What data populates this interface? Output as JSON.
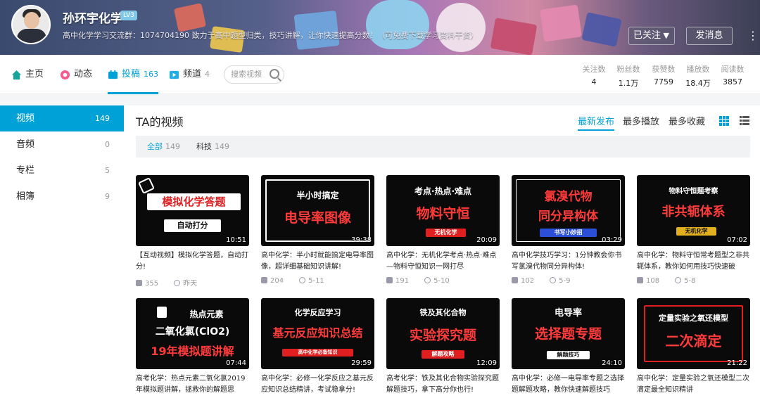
{
  "profile": {
    "username": "孙环宇化学",
    "level": "LV3",
    "sign": "高中化学学习交流群：1074704190 致力于高中题型归类，技巧讲解，让你快速提高分数！（可免费下载学习资料干货）",
    "follow_label": "已关注",
    "message_label": "发消息",
    "more_label": "⋮"
  },
  "nav": {
    "tabs": [
      {
        "label": "主页",
        "count": ""
      },
      {
        "label": "动态",
        "count": ""
      },
      {
        "label": "投稿",
        "count": "163"
      },
      {
        "label": "频道",
        "count": "4"
      }
    ],
    "search_placeholder": "搜索视频",
    "stats": [
      {
        "label": "关注数",
        "value": "4"
      },
      {
        "label": "粉丝数",
        "value": "1.1万"
      },
      {
        "label": "获赞数",
        "value": "7759"
      },
      {
        "label": "播放数",
        "value": "18.4万"
      },
      {
        "label": "阅读数",
        "value": "3857"
      }
    ]
  },
  "sidebar": {
    "items": [
      {
        "label": "视频",
        "count": "149"
      },
      {
        "label": "音频",
        "count": "0"
      },
      {
        "label": "专栏",
        "count": "5"
      },
      {
        "label": "相簿",
        "count": "9"
      }
    ]
  },
  "content": {
    "title": "TA的视频",
    "sort_options": [
      "最新发布",
      "最多播放",
      "最多收藏"
    ],
    "filters": [
      {
        "label": "全部",
        "count": "149"
      },
      {
        "label": "科技",
        "count": "149"
      }
    ],
    "videos": [
      {
        "thumb": [
          "模拟化学答题",
          "自动打分"
        ],
        "duration": "10:51",
        "title": "【互动视频】模拟化学答题，自动打分!",
        "plays": "355",
        "date": "昨天"
      },
      {
        "thumb": [
          "半小时搞定",
          "电导率图像"
        ],
        "duration": "39:38",
        "title": "高中化学：半小时就能搞定电导率图像，超详细基础知识讲解!",
        "plays": "204",
        "date": "5-11"
      },
      {
        "thumb": [
          "考点·热点·难点",
          "物料守恒",
          "无机化学"
        ],
        "duration": "20:09",
        "title": "高中化学：无机化学考点·热点·难点—物料守恒知识一网打尽",
        "plays": "191",
        "date": "5-10"
      },
      {
        "thumb": [
          "氯溴代物",
          "同分异构体",
          "书写小妙招"
        ],
        "duration": "03:29",
        "title": "高中化学技巧学习：1分钟教会你书写氯溴代物同分异构体!",
        "plays": "102",
        "date": "5-9"
      },
      {
        "thumb": [
          "物料守恒题考察",
          "非共轭体系",
          "无机化学"
        ],
        "duration": "07:02",
        "title": "高中化学：物料守恒常考题型之非共轭体系，教你如何用技巧快速破",
        "plays": "108",
        "date": "5-8"
      },
      {
        "thumb": [
          "热点元素",
          "二氧化氯(ClO2)",
          "19年模拟题讲解"
        ],
        "duration": "07:44",
        "title": "高考化学：热点元素二氧化氯2019年模拟题讲解，拯救你的解题思",
        "plays": "",
        "date": ""
      },
      {
        "thumb": [
          "化学反应学习",
          "基元反应知识总结",
          "高中化学必备知识"
        ],
        "duration": "29:59",
        "title": "高中化学：必修一化学反应之基元反应知识总结精讲，考试稳拿分!",
        "plays": "",
        "date": ""
      },
      {
        "thumb": [
          "铁及其化合物",
          "实验探究题",
          "解题攻略"
        ],
        "duration": "12:09",
        "title": "高考化学：铁及其化合物实验探究题解题技巧，拿下高分你也行!",
        "plays": "",
        "date": ""
      },
      {
        "thumb": [
          "电导率",
          "选择题专题",
          "解题技巧"
        ],
        "duration": "24:10",
        "title": "高中化学：必修一电导率专题之选择题解题攻略，教你快速解题技巧",
        "plays": "",
        "date": ""
      },
      {
        "thumb": [
          "定量实验之氧还模型",
          "二次滴定"
        ],
        "duration": "21:22",
        "title": "高中化学：定量实验之氧还模型二次滴定最全知识精讲",
        "plays": "",
        "date": ""
      }
    ]
  },
  "colors": {
    "accent": "#00a1d6",
    "thumb_red": "#ff3b3b"
  }
}
